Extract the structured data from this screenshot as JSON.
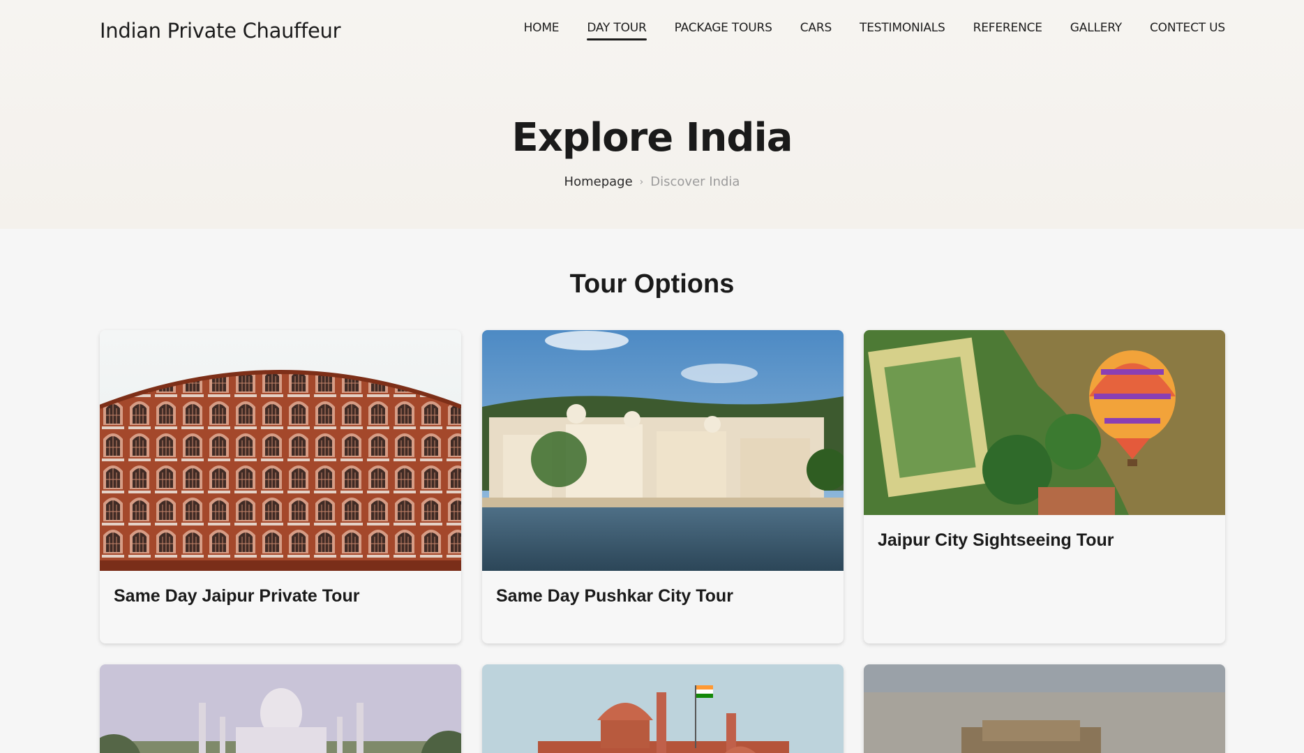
{
  "header": {
    "brand": "Indian Private Chauffeur",
    "nav": [
      {
        "label": "HOME",
        "active": false
      },
      {
        "label": "DAY TOUR",
        "active": true
      },
      {
        "label": "PACKAGE TOURS",
        "active": false
      },
      {
        "label": "CARS",
        "active": false
      },
      {
        "label": "TESTIMONIALS",
        "active": false
      },
      {
        "label": "REFERENCE",
        "active": false
      },
      {
        "label": "GALLERY",
        "active": false
      },
      {
        "label": "CONTECT US",
        "active": false
      }
    ]
  },
  "hero": {
    "title": "Explore India",
    "breadcrumb": {
      "home": "Homepage",
      "current": "Discover India"
    }
  },
  "tours": {
    "heading": "Tour Options",
    "cards": [
      {
        "title": "Same Day Jaipur Private Tour",
        "image": "hawa-mahal-photo"
      },
      {
        "title": "Same Day Pushkar City Tour",
        "image": "pushkar-ghats-photo"
      },
      {
        "title": "Jaipur City Sightseeing Tour",
        "image": "hot-air-balloon-photo"
      },
      {
        "title": "",
        "image": "taj-mahal-photo"
      },
      {
        "title": "",
        "image": "red-fort-photo"
      },
      {
        "title": "",
        "image": "city-aerial-photo"
      }
    ]
  }
}
